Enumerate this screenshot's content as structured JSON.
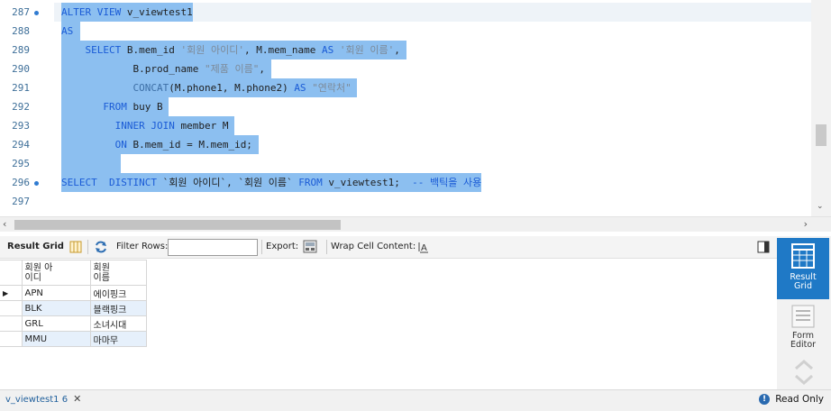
{
  "editor": {
    "lines": [
      {
        "num": "287",
        "dot": true
      },
      {
        "num": "288",
        "dot": false
      },
      {
        "num": "289",
        "dot": false
      },
      {
        "num": "290",
        "dot": false
      },
      {
        "num": "291",
        "dot": false
      },
      {
        "num": "292",
        "dot": false
      },
      {
        "num": "293",
        "dot": false
      },
      {
        "num": "294",
        "dot": false
      },
      {
        "num": "295",
        "dot": false
      },
      {
        "num": "296",
        "dot": true
      },
      {
        "num": "297",
        "dot": false
      }
    ],
    "code": {
      "l287": {
        "kw1": "ALTER VIEW",
        "rest": " v_viewtest1"
      },
      "l288": {
        "kw1": "AS"
      },
      "l289": {
        "kw1": "SELECT",
        "p1": " B.mem_id ",
        "s1": "'회원 아이디'",
        "p2": ", M.mem_name ",
        "kw2": "AS",
        "p3": " ",
        "s2": "'회원 이름'",
        "p4": ","
      },
      "l290": {
        "p1": "B.prod_name ",
        "s1": "\"제품 이름\"",
        "p2": ","
      },
      "l291": {
        "fn": "CONCAT",
        "p1": "(M.phone1, M.phone2) ",
        "kw1": "AS",
        "p2": " ",
        "s1": "\"연락처\""
      },
      "l292": {
        "kw1": "FROM",
        "p1": " buy B"
      },
      "l293": {
        "kw1": "INNER JOIN",
        "p1": " member M"
      },
      "l294": {
        "kw1": "ON",
        "p1": " B.mem_id = M.mem_id;"
      },
      "l296": {
        "kw1": "SELECT",
        "p1": "  ",
        "kw2": "DISTINCT",
        "p2": " `회원 아이디`, `회원 이름` ",
        "kw3": "FROM",
        "p3": " v_viewtest1;  ",
        "cm": "-- 백틱을 사용"
      }
    }
  },
  "toolbar": {
    "result_grid_label": "Result Grid",
    "filter_rows_label": "Filter Rows:",
    "filter_value": "",
    "export_label": "Export:",
    "wrap_label": "Wrap Cell Content:"
  },
  "grid": {
    "headers": [
      "회원 아\n이디",
      "회원\n이름"
    ],
    "rows": [
      [
        "APN",
        "에이핑크"
      ],
      [
        "BLK",
        "블랙핑크"
      ],
      [
        "GRL",
        "소녀시대"
      ],
      [
        "MMU",
        "마마무"
      ]
    ]
  },
  "side": {
    "result_grid": "Result\nGrid",
    "form_editor": "Form\nEditor"
  },
  "status": {
    "tab_label": "v_viewtest1 6",
    "readonly_label": "Read Only"
  },
  "colors": {
    "selection": "#8cbff0",
    "keyword": "#1a5bd6",
    "accent": "#1f79c6"
  }
}
